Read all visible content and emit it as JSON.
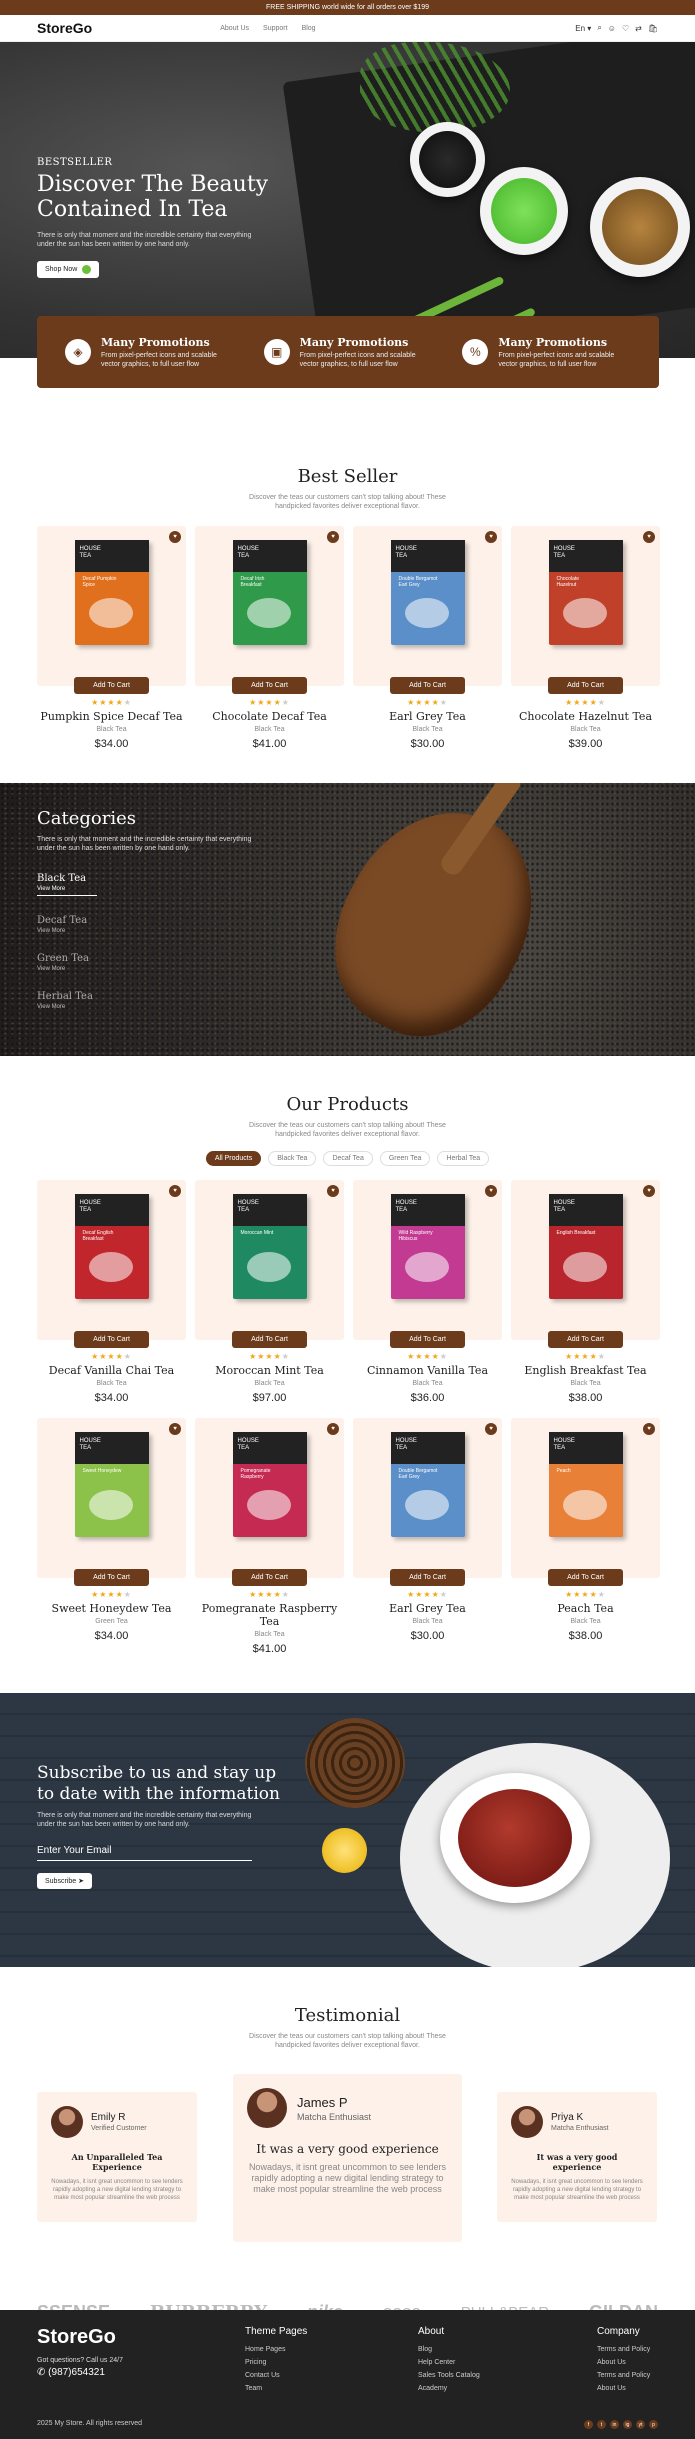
{
  "topbar": {
    "text": "FREE SHIPPING world wide for all orders over $199"
  },
  "header": {
    "logo": "StoreGo",
    "nav": [
      "About Us",
      "Support",
      "Blog"
    ],
    "lang": "En"
  },
  "hero": {
    "kicker": "BESTSELLER",
    "title": "Discover The Beauty Contained In Tea",
    "subtitle": "There is only that moment and the incredible certainty that everything under the sun has been written by one hand only.",
    "button": "Shop Now"
  },
  "promos": [
    {
      "title": "Many Promotions",
      "desc": "From pixel-perfect icons and scalable vector graphics, to full user flow"
    },
    {
      "title": "Many Promotions",
      "desc": "From pixel-perfect icons and scalable vector graphics, to full user flow"
    },
    {
      "title": "Many Promotions",
      "desc": "From pixel-perfect icons and scalable vector graphics, to full user flow"
    }
  ],
  "bestseller": {
    "title": "Best Seller",
    "subtitle": "Discover the teas our customers can't stop talking about! These handpicked favorites deliver exceptional flavor.",
    "products": [
      {
        "name": "Pumpkin Spice Decaf Tea",
        "category": "Black Tea",
        "price": "$34.00",
        "rating": 4,
        "color": "#e0701e",
        "label": "Decaf Pumpkin Spice"
      },
      {
        "name": "Chocolate Decaf Tea",
        "category": "Black Tea",
        "price": "$41.00",
        "rating": 4,
        "color": "#2e9a4a",
        "label": "Decaf Irish Breakfast"
      },
      {
        "name": "Earl Grey Tea",
        "category": "Black Tea",
        "price": "$30.00",
        "rating": 4,
        "color": "#5b8fc9",
        "label": "Double Bergamot Earl Grey"
      },
      {
        "name": "Chocolate Hazelnut Tea",
        "category": "Black Tea",
        "price": "$39.00",
        "rating": 4,
        "color": "#c0402a",
        "label": "Chocolate Hazelnut"
      }
    ]
  },
  "add_to_cart": "Add To Cart",
  "categories": {
    "title": "Categories",
    "subtitle": "There is only that moment and the incredible certainty that everything under the sun has been written by one hand only.",
    "view": "View More",
    "items": [
      "Black Tea",
      "Decaf Tea",
      "Green Tea",
      "Herbal Tea"
    ]
  },
  "products": {
    "title": "Our Products",
    "subtitle": "Discover the teas our customers can't stop talking about! These handpicked favorites deliver exceptional flavor.",
    "filters": [
      "All Products",
      "Black Tea",
      "Decaf Tea",
      "Green Tea",
      "Herbal Tea"
    ],
    "items": [
      {
        "name": "Decaf Vanilla Chai Tea",
        "category": "Black Tea",
        "price": "$34.00",
        "rating": 4,
        "color": "#c0262b",
        "label": "Decaf English Breakfast"
      },
      {
        "name": "Moroccan Mint Tea",
        "category": "Black Tea",
        "price": "$97.00",
        "rating": 4,
        "color": "#1f8a62",
        "label": "Moroccan Mint"
      },
      {
        "name": "Cinnamon Vanilla Tea",
        "category": "Black Tea",
        "price": "$36.00",
        "rating": 4,
        "color": "#c23a92",
        "label": "Wild Raspberry Hibiscus"
      },
      {
        "name": "English Breakfast Tea",
        "category": "Black Tea",
        "price": "$38.00",
        "rating": 4,
        "color": "#b9252c",
        "label": "English Breakfast"
      },
      {
        "name": "Sweet Honeydew Tea",
        "category": "Green Tea",
        "price": "$34.00",
        "rating": 4,
        "color": "#8cc24a",
        "label": "Sweet Honeydew"
      },
      {
        "name": "Pomegranate Raspberry Tea",
        "category": "Black Tea",
        "price": "$41.00",
        "rating": 4,
        "color": "#c42a52",
        "label": "Pomegranate Raspberry"
      },
      {
        "name": "Earl Grey Tea",
        "category": "Black Tea",
        "price": "$30.00",
        "rating": 4,
        "color": "#5b8fc9",
        "label": "Double Bergamot Earl Grey"
      },
      {
        "name": "Peach Tea",
        "category": "Black Tea",
        "price": "$38.00",
        "rating": 4,
        "color": "#e88038",
        "label": "Peach"
      }
    ]
  },
  "subscribe": {
    "title": "Subscribe to us and stay up to date with the information",
    "desc": "There is only that moment and the incredible certainty that everything under the sun has been written by one hand only.",
    "placeholder": "Enter Your Email",
    "button": "Subscribe"
  },
  "testimonial": {
    "title": "Testimonial",
    "subtitle": "Discover the teas our customers can't stop talking about! These handpicked favorites deliver exceptional flavor.",
    "items": [
      {
        "name": "Emily R",
        "role": "Verified Customer",
        "quote": "An Unparalleled Tea Experience",
        "body": "Nowadays, it isnt great uncommon to see lenders rapidly adopting a new digital lending strategy to make most popular streamline the web process"
      },
      {
        "name": "James P",
        "role": "Matcha Enthusiast",
        "quote": "It was a very good experience",
        "body": "Nowadays, it isnt great uncommon to see lenders rapidly adopting a new digital lending strategy to make most popular streamline the web process"
      },
      {
        "name": "Priya K",
        "role": "Matcha Enthusiast",
        "quote": "It was a very good experience",
        "body": "Nowadays, it isnt great uncommon to see lenders rapidly adopting a new digital lending strategy to make most popular streamline the web process"
      }
    ]
  },
  "brands": [
    "SSENSE",
    "BURBERRY",
    "nike",
    "asos",
    "PULL&BEAR",
    "GILDAN"
  ],
  "footer": {
    "logo": "StoreGo",
    "question": "Got questions? Call us 24/7",
    "phone": "(987)654321",
    "cols": [
      {
        "title": "Theme Pages",
        "links": [
          "Home Pages",
          "Pricing",
          "Contact Us",
          "Team"
        ]
      },
      {
        "title": "About",
        "links": [
          "Blog",
          "Help Center",
          "Sales Tools Catalog",
          "Academy"
        ]
      },
      {
        "title": "Company",
        "links": [
          "Terms and Policy",
          "About Us",
          "Terms and Policy",
          "About Us"
        ]
      }
    ],
    "copyright": "2025 My Store. All rights reserved",
    "social": [
      "f",
      "t",
      "in",
      "ig",
      "yt",
      "p"
    ]
  }
}
